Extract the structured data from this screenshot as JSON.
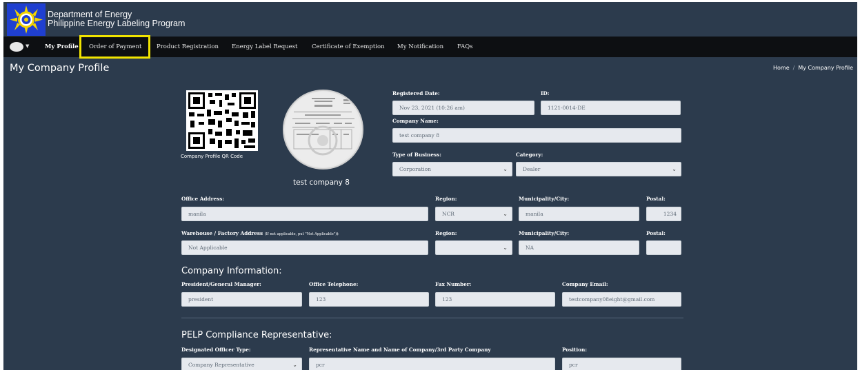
{
  "header": {
    "org_line1": "Department of Energy",
    "org_line2": "Philippine Energy Labeling Program"
  },
  "nav": {
    "items": [
      {
        "label": "My Profile"
      },
      {
        "label": "Order of Payment"
      },
      {
        "label": "Product Registration"
      },
      {
        "label": "Energy Label Request"
      },
      {
        "label": "Certificate of Exemption"
      },
      {
        "label": "My Notification"
      },
      {
        "label": "FAQs"
      }
    ],
    "highlight_color": "#f1e400"
  },
  "page": {
    "title": "My Company Profile",
    "breadcrumb": [
      "Home",
      "My Company Profile"
    ]
  },
  "profile": {
    "qr_label": "Company Profile QR Code",
    "company_display_name": "test company 8"
  },
  "form": {
    "registered_date": {
      "label": "Registered Date:",
      "value": "Nov 23, 2021 (10:26 am)"
    },
    "id": {
      "label": "ID:",
      "value": "1121-0014-DE"
    },
    "company_name": {
      "label": "Company Name:",
      "value": "test company 8"
    },
    "type_of_business": {
      "label": "Type of Business:",
      "value": "Corporation"
    },
    "category": {
      "label": "Category:",
      "value": "Dealer"
    },
    "office_address": {
      "label": "Office Address:",
      "value": "manila"
    },
    "region": {
      "label": "Region:",
      "value": "NCR"
    },
    "municipality": {
      "label": "Municipality/City:",
      "value": "manila"
    },
    "postal": {
      "label": "Postal:",
      "value": "1234"
    },
    "warehouse_address": {
      "label": "Warehouse / Factory Address",
      "note": "(If not applicable, put \"Not Applicable\")‡",
      "value": "Not Applicable"
    },
    "warehouse_region": {
      "label": "Region:",
      "value": ""
    },
    "warehouse_municipality": {
      "label": "Municipality/City:",
      "value": "NA"
    },
    "warehouse_postal": {
      "label": "Postal:",
      "value": ""
    }
  },
  "company_info": {
    "heading": "Company Information:",
    "president": {
      "label": "President/General Manager:",
      "value": "president"
    },
    "telephone": {
      "label": "Office Telephone:",
      "value": "123"
    },
    "fax": {
      "label": "Fax Number:",
      "value": "123"
    },
    "email": {
      "label": "Company Email:",
      "value": "testcompany08eight@gmail.com"
    }
  },
  "pelp": {
    "heading": "PELP Compliance Representative:",
    "officer_type": {
      "label": "Designated Officer Type:",
      "value": "Company Representative"
    },
    "rep_name": {
      "label": "Representative Name and Name of Company/3rd Party Company",
      "value": "pcr"
    },
    "position": {
      "label": "Position:",
      "value": "pcr"
    }
  },
  "icons": {
    "select_chevron": "chevron-down-icon",
    "user_caret": "caret-down-icon"
  }
}
